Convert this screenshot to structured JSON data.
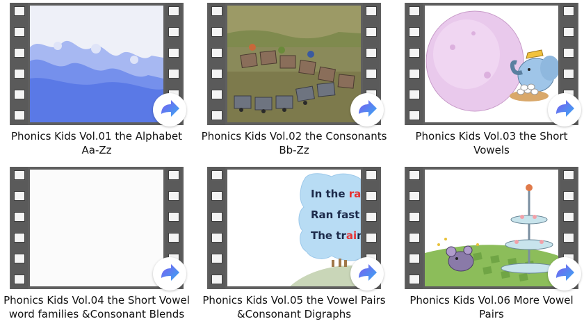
{
  "videos": [
    {
      "title": "Phonics Kids Vol.01 the Alphabet Aa-Zz",
      "thumbnail": "watercolor-sky"
    },
    {
      "title": "Phonics Kids Vol.02 the Consonants Bb-Zz",
      "thumbnail": "cartoon-train"
    },
    {
      "title": "Phonics Kids Vol.03 the Short Vowels",
      "thumbnail": "elephant-with-eggs"
    },
    {
      "title": "Phonics Kids Vol.04 the Short Vowel word families &Consonant Blends",
      "thumbnail": "blank-white"
    },
    {
      "title": "Phonics Kids Vol.05 the Vowel Pairs &Consonant Digraphs",
      "thumbnail": "rain-speech-bubble"
    },
    {
      "title": "Phonics Kids Vol.06 More Vowel Pairs",
      "thumbnail": "mouse-and-cake-stand"
    }
  ],
  "thumbnail_text": {
    "line1_start": "In the ",
    "line1_red": "rai",
    "line2": "Ran fast i",
    "line3_start": "The tr",
    "line3_red": "ai",
    "line3_end": "n"
  },
  "icons": {
    "play": "play-arrow-icon",
    "play_gradient_start": "#7a5cf0",
    "play_gradient_end": "#3aa8f2"
  }
}
